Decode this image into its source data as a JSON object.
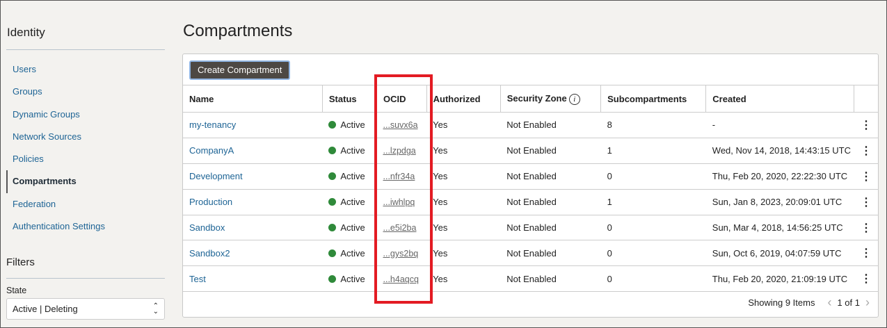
{
  "sidebar": {
    "title": "Identity",
    "items": [
      "Users",
      "Groups",
      "Dynamic Groups",
      "Network Sources",
      "Policies",
      "Compartments",
      "Federation",
      "Authentication Settings"
    ],
    "active": "Compartments"
  },
  "filters": {
    "title": "Filters",
    "state_label": "State",
    "state_value": "Active | Deleting"
  },
  "page_title": "Compartments",
  "create_button": "Create Compartment",
  "columns": [
    "Name",
    "Status",
    "OCID",
    "Authorized",
    "Security Zone",
    "Subcompartments",
    "Created"
  ],
  "rows": [
    {
      "name": "my-tenancy",
      "status": "Active",
      "ocid": "...suvx6a",
      "authorized": "Yes",
      "zone": "Not Enabled",
      "sub": "8",
      "created": "-"
    },
    {
      "name": "CompanyA",
      "status": "Active",
      "ocid": "...lzpdga",
      "authorized": "Yes",
      "zone": "Not Enabled",
      "sub": "1",
      "created": "Wed, Nov 14, 2018, 14:43:15 UTC"
    },
    {
      "name": "Development",
      "status": "Active",
      "ocid": "...nfr34a",
      "authorized": "Yes",
      "zone": "Not Enabled",
      "sub": "0",
      "created": "Thu, Feb 20, 2020, 22:22:30 UTC"
    },
    {
      "name": "Production",
      "status": "Active",
      "ocid": "...iwhlpq",
      "authorized": "Yes",
      "zone": "Not Enabled",
      "sub": "1",
      "created": "Sun, Jan 8, 2023, 20:09:01 UTC"
    },
    {
      "name": "Sandbox",
      "status": "Active",
      "ocid": "...e5i2ba",
      "authorized": "Yes",
      "zone": "Not Enabled",
      "sub": "0",
      "created": "Sun, Mar 4, 2018, 14:56:25 UTC"
    },
    {
      "name": "Sandbox2",
      "status": "Active",
      "ocid": "...gys2bq",
      "authorized": "Yes",
      "zone": "Not Enabled",
      "sub": "0",
      "created": "Sun, Oct 6, 2019, 04:07:59 UTC"
    },
    {
      "name": "Test",
      "status": "Active",
      "ocid": "...h4aqcq",
      "authorized": "Yes",
      "zone": "Not Enabled",
      "sub": "0",
      "created": "Thu, Feb 20, 2020, 21:09:19 UTC"
    }
  ],
  "footer": {
    "showing": "Showing 9 Items",
    "page": "1 of 1"
  },
  "colors": {
    "active_status": "#2f8a3a",
    "highlight": "#e31b23",
    "link": "#1e6495"
  }
}
